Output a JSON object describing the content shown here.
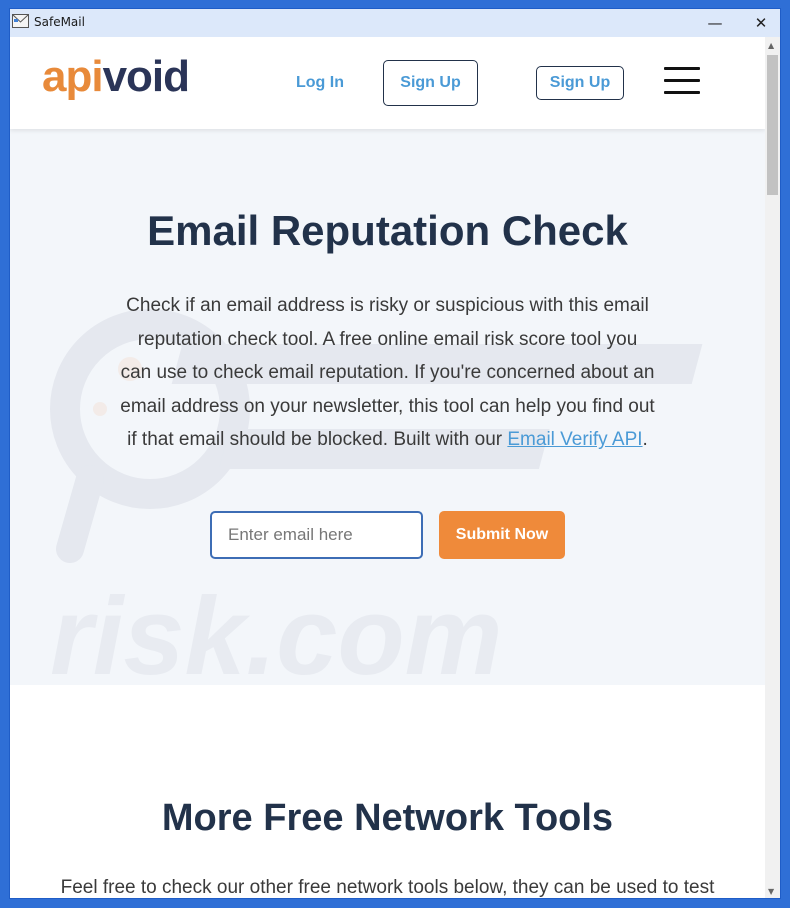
{
  "window": {
    "title": "SafeMail",
    "minimize_glyph": "—",
    "close_glyph": "✕",
    "icon": "mail-icon"
  },
  "scrollbar": {
    "up_glyph": "▲",
    "down_glyph": "▼"
  },
  "nav": {
    "logo_part1": "api",
    "logo_part2": "void",
    "login_label": "Log In",
    "signup_label_primary": "Sign Up",
    "signup_label_secondary": "Sign Up",
    "menu_icon": "hamburger-menu-icon"
  },
  "hero": {
    "title": "Email Reputation Check",
    "description_text": "Check if an email address is risky or suspicious with this email reputation check tool. A free online email risk score tool you can use to check email reputation. If you're concerned about an email address on your newsletter, this tool can help you find out if that email should be blocked. Built with our ",
    "description_link": "Email Verify API",
    "description_end": ".",
    "input_placeholder": "Enter email here",
    "submit_label": "Submit Now",
    "watermark_text": "risk.com"
  },
  "more_tools": {
    "title": "More Free Network Tools",
    "description": "Feel free to check our other free network tools below, they can be used to test"
  },
  "colors": {
    "accent_orange": "#ef8a3a",
    "link_blue": "#4a9ad6",
    "heading_navy": "#22324a",
    "hero_bg": "#f3f6fa"
  }
}
